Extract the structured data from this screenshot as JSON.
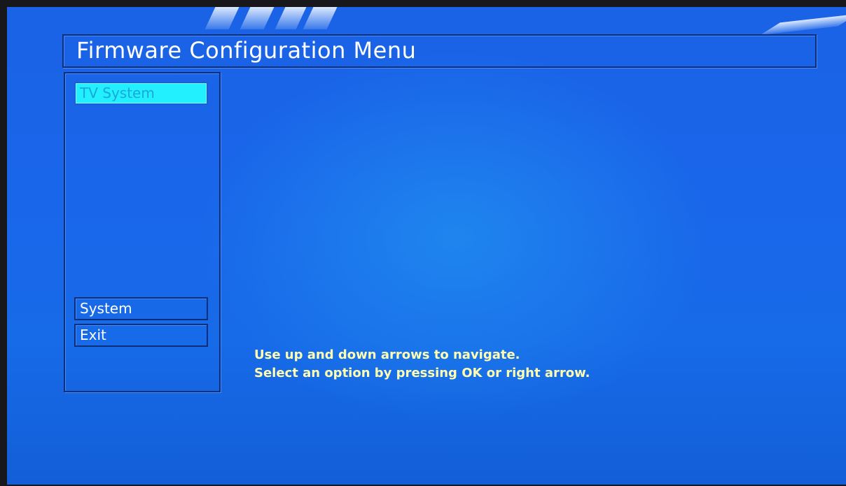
{
  "header": {
    "title": "Firmware Configuration Menu"
  },
  "menu": {
    "items": [
      {
        "label": "TV System",
        "selected": true
      },
      {
        "label": "System",
        "selected": false
      },
      {
        "label": "Exit",
        "selected": false
      }
    ]
  },
  "help": {
    "line1": "Use up and down arrows to navigate.",
    "line2": "Select an option by pressing OK or right arrow."
  },
  "colors": {
    "background": "#1a66ea",
    "selected_item": "#22f0ff",
    "help_text": "#ffffb0",
    "text": "#ffffff"
  }
}
